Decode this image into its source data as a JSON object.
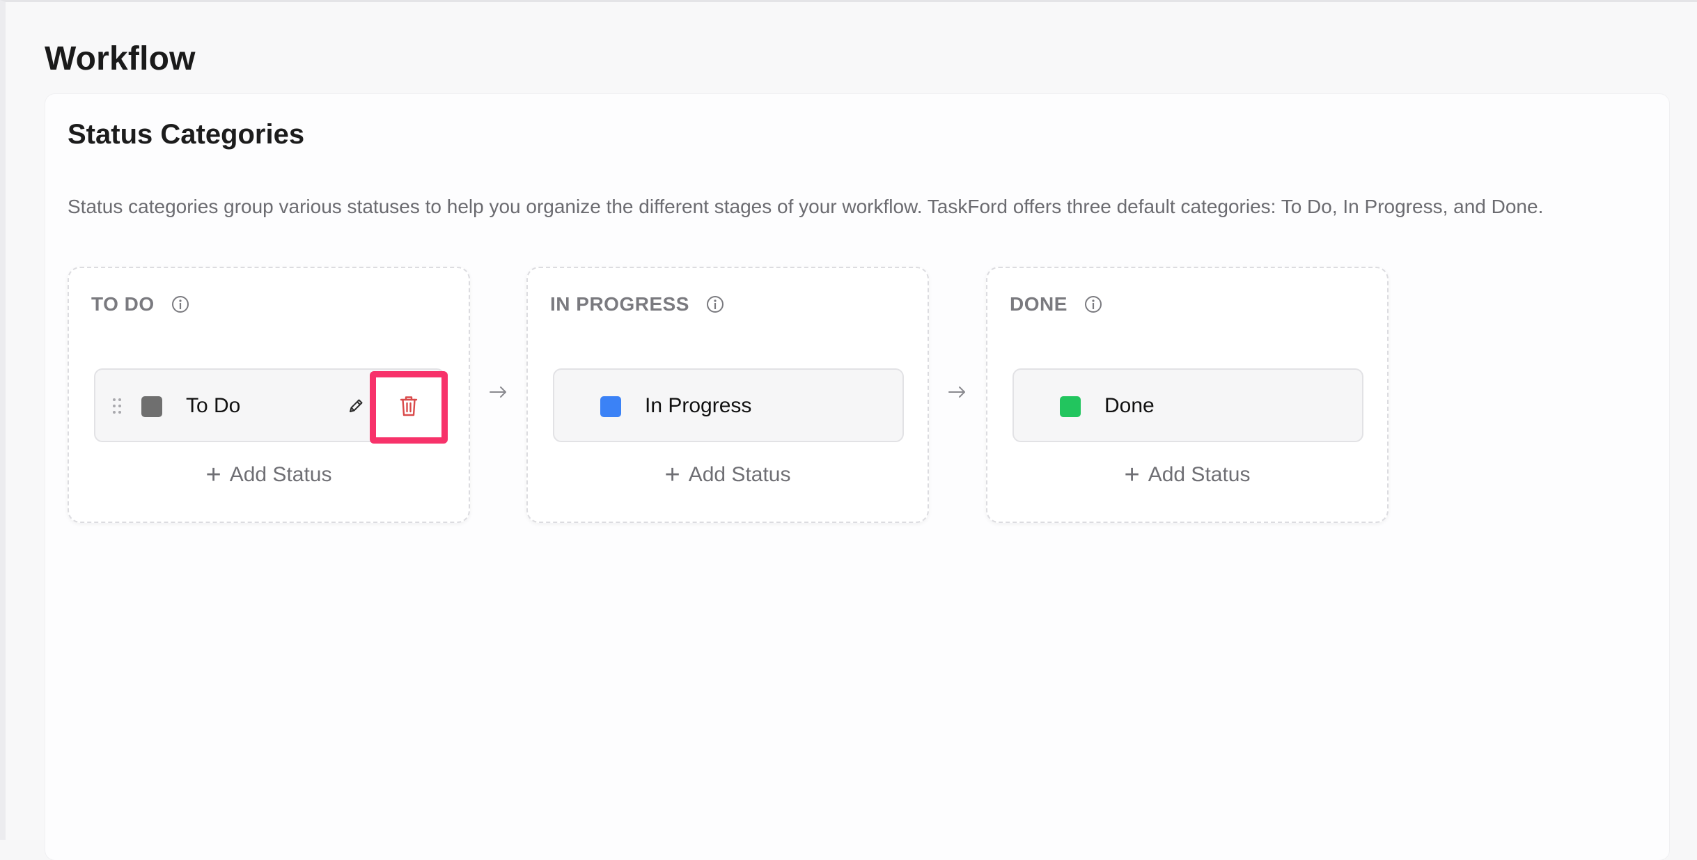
{
  "page": {
    "title": "Workflow"
  },
  "section": {
    "title": "Status Categories",
    "description": "Status categories group various statuses to help you organize the different stages of your workflow. TaskFord offers three default categories: To Do, In Progress, and Done."
  },
  "categories": [
    {
      "title": "TO DO",
      "info_icon": "info-circle-icon",
      "status": {
        "label": "To Do",
        "color": "#6f6f6f"
      },
      "add_label": "Add Status"
    },
    {
      "title": "IN PROGRESS",
      "info_icon": "info-circle-icon",
      "status": {
        "label": "In Progress",
        "color": "#3b82f6"
      },
      "add_label": "Add Status"
    },
    {
      "title": "DONE",
      "info_icon": "info-circle-icon",
      "status": {
        "label": "Done",
        "color": "#22c55e"
      },
      "add_label": "Add Status"
    }
  ],
  "colors": {
    "highlight": "#f7326a",
    "delete_icon": "#d94a4a"
  }
}
